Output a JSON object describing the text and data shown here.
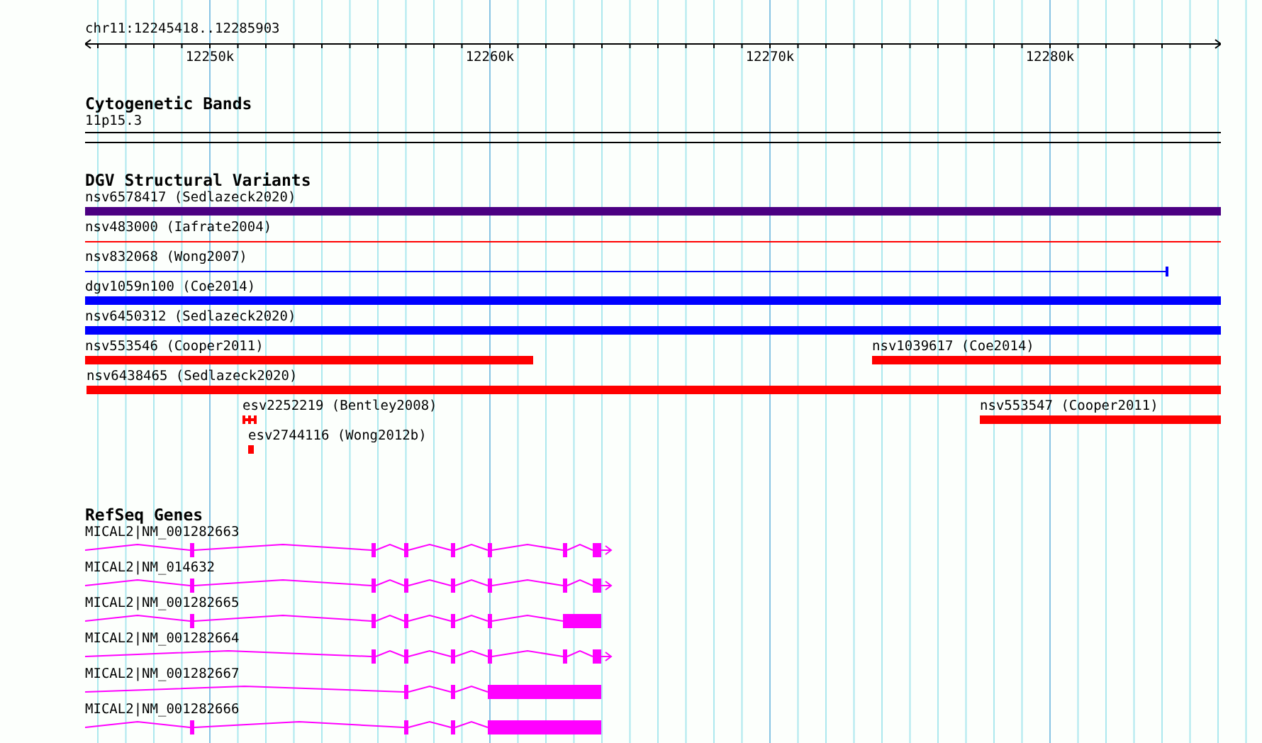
{
  "ruler": {
    "location": "chr11:12245418..12285903",
    "ticks": [
      "12250k",
      "12260k",
      "12270k",
      "12280k"
    ]
  },
  "cytoband_track": {
    "title": "Cytogenetic Bands",
    "band": "11p15.3"
  },
  "variant_track": {
    "title": "DGV Structural Variants",
    "features": [
      {
        "label": "nsv6578417 (Sedlazeck2020)",
        "kind": "bar",
        "color": "#4b0082"
      },
      {
        "label": "nsv483000 (Iafrate2004)",
        "kind": "line",
        "color": "#ff0000"
      },
      {
        "label": "nsv832068 (Wong2007)",
        "kind": "line",
        "color": "#0000ff"
      },
      {
        "label": "dgv1059n100 (Coe2014)",
        "kind": "bar",
        "color": "#0000ff"
      },
      {
        "label": "nsv6450312 (Sedlazeck2020)",
        "kind": "bar",
        "color": "#0000ff"
      },
      {
        "label": "nsv553546 (Cooper2011)",
        "kind": "bar",
        "color": "#ff0000"
      },
      {
        "label": "nsv1039617 (Coe2014)",
        "kind": "bar",
        "color": "#ff0000"
      },
      {
        "label": "nsv6438465 (Sedlazeck2020)",
        "kind": "bar",
        "color": "#ff0000"
      },
      {
        "label": "esv2252219 (Bentley2008)",
        "kind": "marks",
        "color": "#ff0000"
      },
      {
        "label": "nsv553547 (Cooper2011)",
        "kind": "bar",
        "color": "#ff0000"
      },
      {
        "label": "esv2744116 (Wong2012b)",
        "kind": "marks",
        "color": "#ff0000"
      }
    ]
  },
  "gene_track": {
    "title": "RefSeq Genes",
    "genes": [
      {
        "label": "MICAL2|NM_001282663"
      },
      {
        "label": "MICAL2|NM_014632"
      },
      {
        "label": "MICAL2|NM_001282665"
      },
      {
        "label": "MICAL2|NM_001282664"
      },
      {
        "label": "MICAL2|NM_001282667"
      },
      {
        "label": "MICAL2|NM_001282666"
      }
    ]
  }
}
